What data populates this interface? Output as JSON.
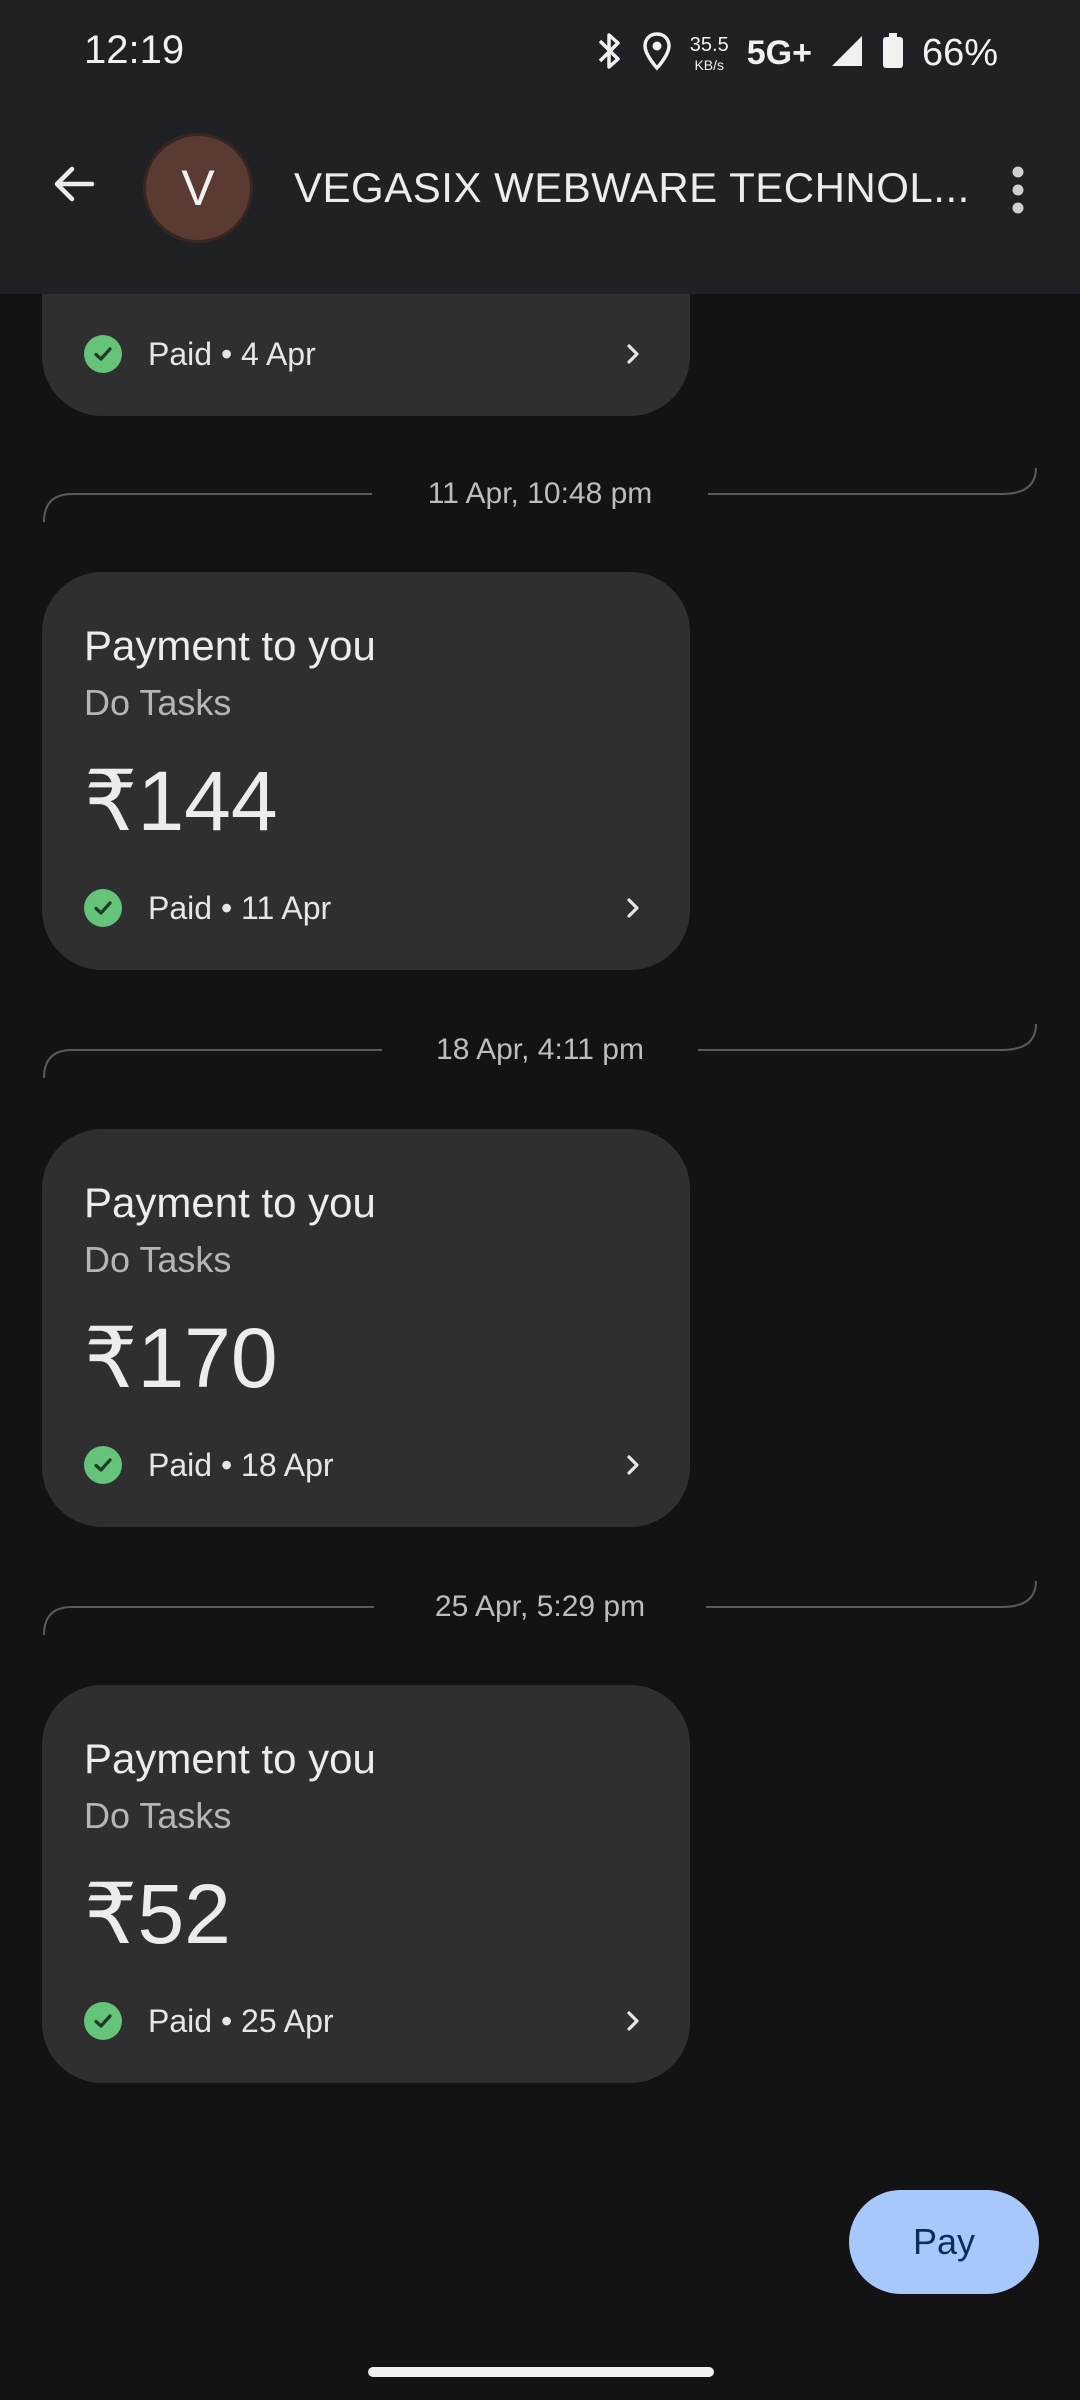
{
  "status_bar": {
    "time": "12:19",
    "net_speed_value": "35.5",
    "net_speed_unit": "KB/s",
    "network": "5G+",
    "battery": "66%",
    "icons": [
      "bluetooth-icon",
      "location-icon",
      "signal-icon",
      "battery-icon"
    ]
  },
  "header": {
    "avatar_initial": "V",
    "contact_name": "VEGASIX WEBWARE TECHNOL..."
  },
  "messages": [
    {
      "status": "Paid • 4 Apr"
    },
    {
      "timestamp": "11 Apr, 10:48 pm",
      "title": "Payment to you",
      "note": "Do Tasks",
      "amount": "₹144",
      "status": "Paid • 11 Apr"
    },
    {
      "timestamp": "18 Apr, 4:11 pm",
      "title": "Payment to you",
      "note": "Do Tasks",
      "amount": "₹170",
      "status": "Paid • 18 Apr"
    },
    {
      "timestamp": "25 Apr, 5:29 pm",
      "title": "Payment to you",
      "note": "Do Tasks",
      "amount": "₹52",
      "status": "Paid • 25 Apr"
    }
  ],
  "pay_button": {
    "label": "Pay",
    "color": "#a8c7fa"
  },
  "colors": {
    "paid_check": "#66c37a",
    "card_bg": "#2f2f2f",
    "background": "#131313"
  }
}
